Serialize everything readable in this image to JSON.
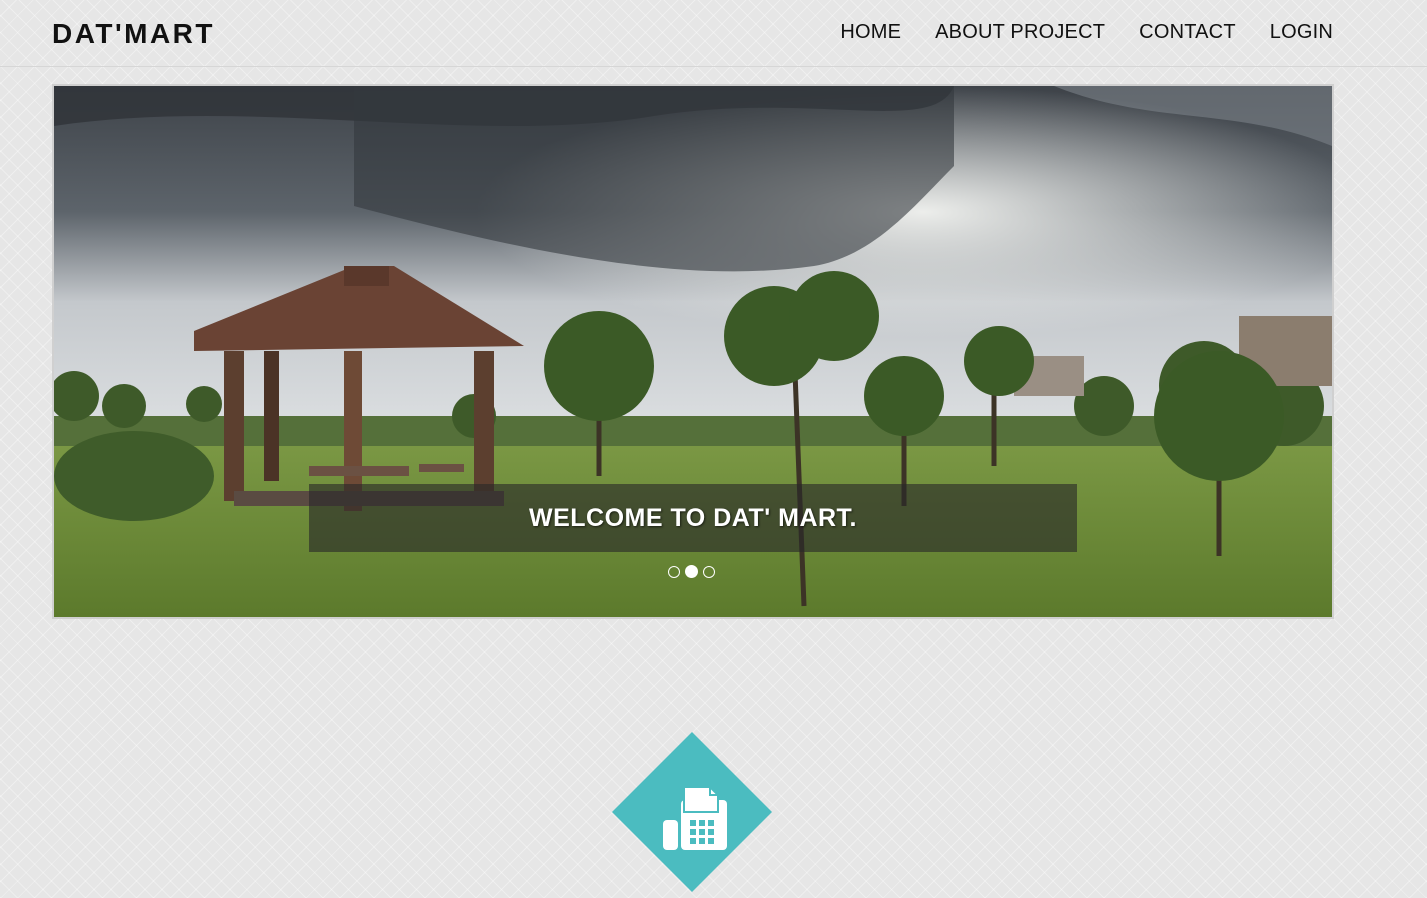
{
  "brand": "DAT'MART",
  "nav": {
    "items": [
      "HOME",
      "ABOUT PROJECT",
      "CONTACT",
      "LOGIN"
    ]
  },
  "carousel": {
    "caption": "WELCOME TO DAT' MART.",
    "slide_count": 3,
    "active_slide": 2
  },
  "colors": {
    "accent": "#4bbcc0",
    "background": "#e6e6e6"
  },
  "icons": {
    "contact": "fax-icon"
  }
}
